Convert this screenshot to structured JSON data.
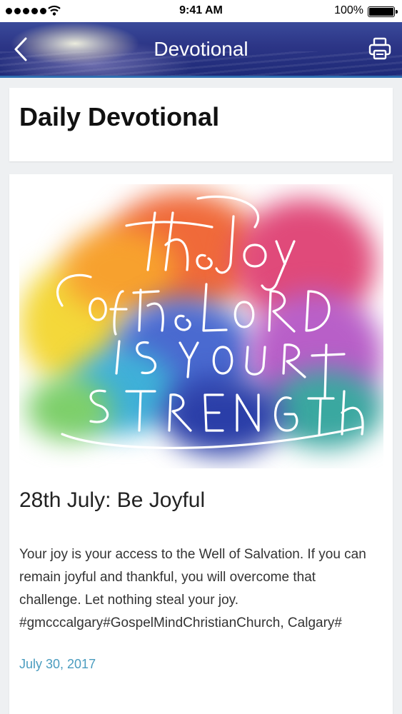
{
  "status_bar": {
    "time": "9:41 AM",
    "battery": "100%",
    "icons": [
      "signal-dots-icon",
      "wifi-icon",
      "battery-icon"
    ]
  },
  "nav": {
    "title": "Devotional",
    "back_icon": "chevron-left-icon",
    "print_icon": "printer-icon"
  },
  "header": {
    "title": "Daily Devotional"
  },
  "post": {
    "artwork_text": "the joy of the Lord is your strength",
    "title": "28th July: Be Joyful",
    "body": "Your joy is your access to the Well of Salvation. If you can remain joyful and thankful, you will overcome that challenge. Let nothing steal your joy. #gmcccalgary#GospelMindChristianChurch, Calgary#",
    "date": "July 30, 2017"
  },
  "colors": {
    "nav_blue": "#2c3586",
    "date_link": "#4a9cbf",
    "background": "#eef0f2"
  }
}
